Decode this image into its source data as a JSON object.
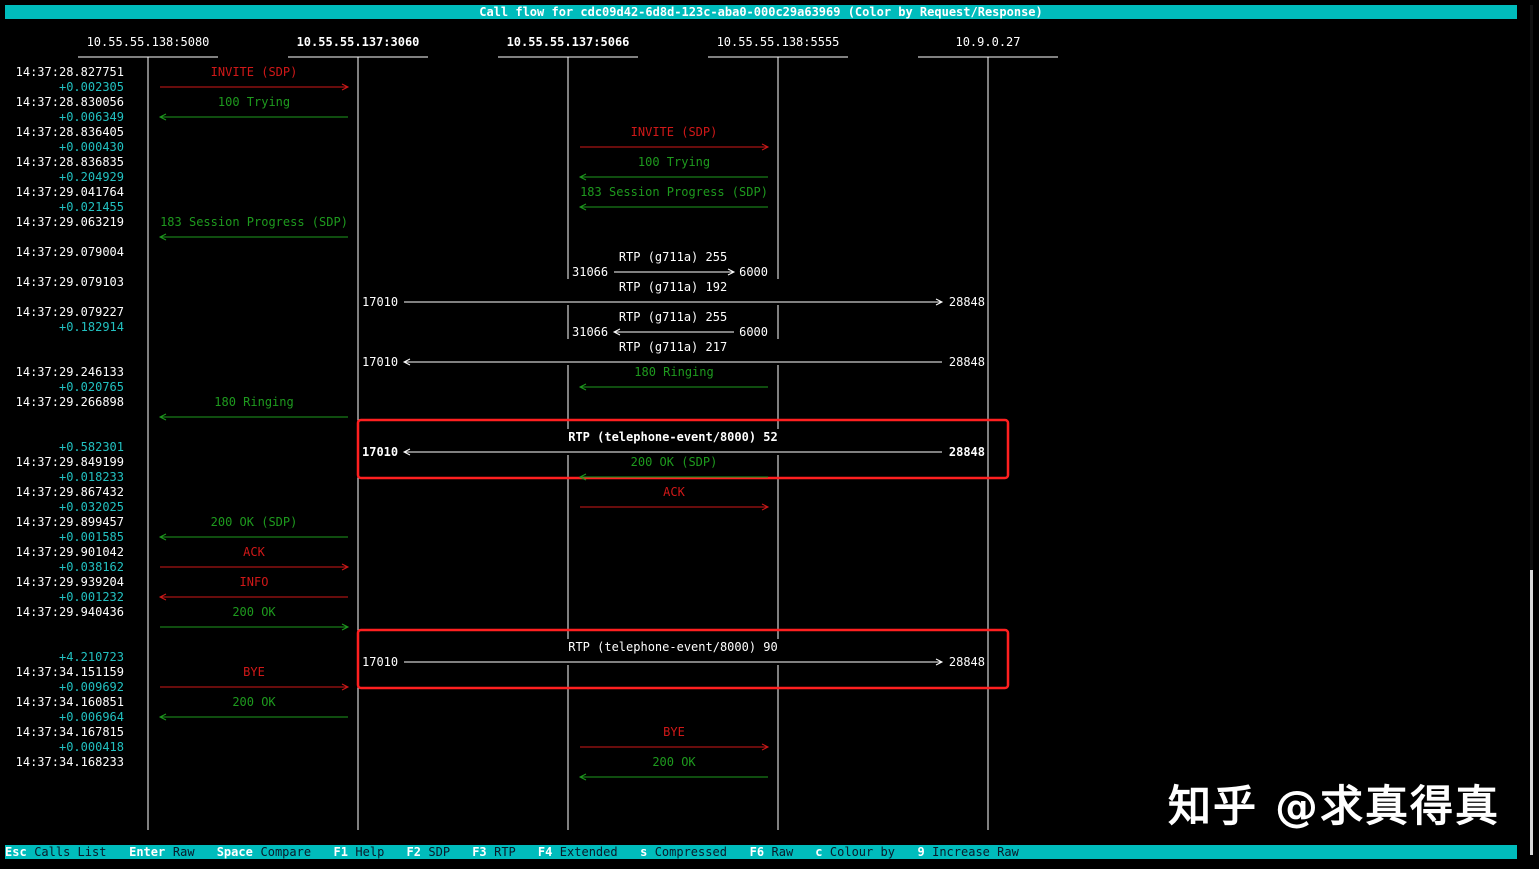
{
  "title": "Call flow for cdc09d42-6d8d-123c-aba0-000c29a63969 (Color by Request/Response)",
  "colors": {
    "request": "#d01818",
    "response": "#1e9a1e",
    "delta": "#22c0c0",
    "rtp": "#ffffff",
    "highlight": "#ff2020",
    "bar": "#00bcbc"
  },
  "endpoints": [
    "10.55.55.138:5080",
    "10.55.55.137:3060",
    "10.55.55.137:5066",
    "10.55.55.138:5555",
    "10.9.0.27"
  ],
  "active_endpoints": [
    1,
    2
  ],
  "rows": [
    {
      "time": "14:37:28.827751",
      "delta": "+0.002305",
      "label": "INVITE (SDP)",
      "from": 0,
      "to": 1,
      "kind": "request"
    },
    {
      "time": "14:37:28.830056",
      "delta": "+0.006349",
      "label": "100 Trying",
      "from": 1,
      "to": 0,
      "kind": "response"
    },
    {
      "time": "14:37:28.836405",
      "delta": "+0.000430",
      "label": "INVITE (SDP)",
      "from": 2,
      "to": 3,
      "kind": "request"
    },
    {
      "time": "14:37:28.836835",
      "delta": "+0.204929",
      "label": "100 Trying",
      "from": 3,
      "to": 2,
      "kind": "response"
    },
    {
      "time": "14:37:29.041764",
      "delta": "+0.021455",
      "label": "183 Session Progress (SDP)",
      "from": 3,
      "to": 2,
      "kind": "response"
    },
    {
      "time": "14:37:29.063219",
      "delta": "",
      "label": "183 Session Progress (SDP)",
      "from": 1,
      "to": 0,
      "kind": "response"
    },
    {
      "time": "14:37:29.079004",
      "delta": "",
      "label": "RTP (g711a) 255",
      "from": 2,
      "to": 3,
      "kind": "rtp",
      "port_left": "31066",
      "port_right": "6000"
    },
    {
      "time": "14:37:29.079103",
      "delta": "",
      "label": "RTP (g711a) 192",
      "from": 1,
      "to": 4,
      "kind": "rtp",
      "port_left": "17010",
      "port_right": "28848"
    },
    {
      "time": "14:37:29.079227",
      "delta": "+0.182914",
      "label": "RTP (g711a) 255",
      "from": 3,
      "to": 2,
      "kind": "rtp",
      "port_left": "31066",
      "port_right": "6000"
    },
    {
      "time": "",
      "delta": "",
      "label": "RTP (g711a) 217",
      "from": 4,
      "to": 1,
      "kind": "rtp",
      "port_left": "17010",
      "port_right": "28848"
    },
    {
      "time": "14:37:29.246133",
      "delta": "+0.020765",
      "label": "180 Ringing",
      "from": 3,
      "to": 2,
      "kind": "response"
    },
    {
      "time": "14:37:29.266898",
      "delta": "",
      "label": "180 Ringing",
      "from": 1,
      "to": 0,
      "kind": "response"
    },
    {
      "time": "",
      "delta": "+0.582301",
      "label": "RTP (telephone-event/8000) 52",
      "from": 4,
      "to": 1,
      "kind": "rtp",
      "port_left": "17010",
      "port_right": "28848",
      "bold": true,
      "highlight": true
    },
    {
      "time": "14:37:29.849199",
      "delta": "+0.018233",
      "label": "200 OK (SDP)",
      "from": 3,
      "to": 2,
      "kind": "response"
    },
    {
      "time": "14:37:29.867432",
      "delta": "+0.032025",
      "label": "ACK",
      "from": 2,
      "to": 3,
      "kind": "request"
    },
    {
      "time": "14:37:29.899457",
      "delta": "+0.001585",
      "label": "200 OK (SDP)",
      "from": 1,
      "to": 0,
      "kind": "response"
    },
    {
      "time": "14:37:29.901042",
      "delta": "+0.038162",
      "label": "ACK",
      "from": 0,
      "to": 1,
      "kind": "request"
    },
    {
      "time": "14:37:29.939204",
      "delta": "+0.001232",
      "label": "INFO",
      "from": 1,
      "to": 0,
      "kind": "request"
    },
    {
      "time": "14:37:29.940436",
      "delta": "",
      "label": "200 OK",
      "from": 0,
      "to": 1,
      "kind": "response"
    },
    {
      "time": "",
      "delta": "+4.210723",
      "label": "RTP (telephone-event/8000) 90",
      "from": 1,
      "to": 4,
      "kind": "rtp",
      "port_left": "17010",
      "port_right": "28848",
      "highlight": true
    },
    {
      "time": "14:37:34.151159",
      "delta": "+0.009692",
      "label": "BYE",
      "from": 0,
      "to": 1,
      "kind": "request"
    },
    {
      "time": "14:37:34.160851",
      "delta": "+0.006964",
      "label": "200 OK",
      "from": 1,
      "to": 0,
      "kind": "response"
    },
    {
      "time": "14:37:34.167815",
      "delta": "+0.000418",
      "label": "BYE",
      "from": 2,
      "to": 3,
      "kind": "request"
    },
    {
      "time": "14:37:34.168233",
      "delta": "",
      "label": "200 OK",
      "from": 3,
      "to": 2,
      "kind": "response"
    }
  ],
  "footer": [
    {
      "key": "Esc",
      "label": "Calls List"
    },
    {
      "key": "Enter",
      "label": "Raw"
    },
    {
      "key": "Space",
      "label": "Compare"
    },
    {
      "key": "F1",
      "label": "Help"
    },
    {
      "key": "F2",
      "label": "SDP"
    },
    {
      "key": "F3",
      "label": "RTP"
    },
    {
      "key": "F4",
      "label": "Extended"
    },
    {
      "key": "s",
      "label": "Compressed"
    },
    {
      "key": "F6",
      "label": "Raw"
    },
    {
      "key": "c",
      "label": "Colour by"
    },
    {
      "key": "9",
      "label": "Increase Raw"
    }
  ],
  "watermark": "知乎 @求真得真"
}
